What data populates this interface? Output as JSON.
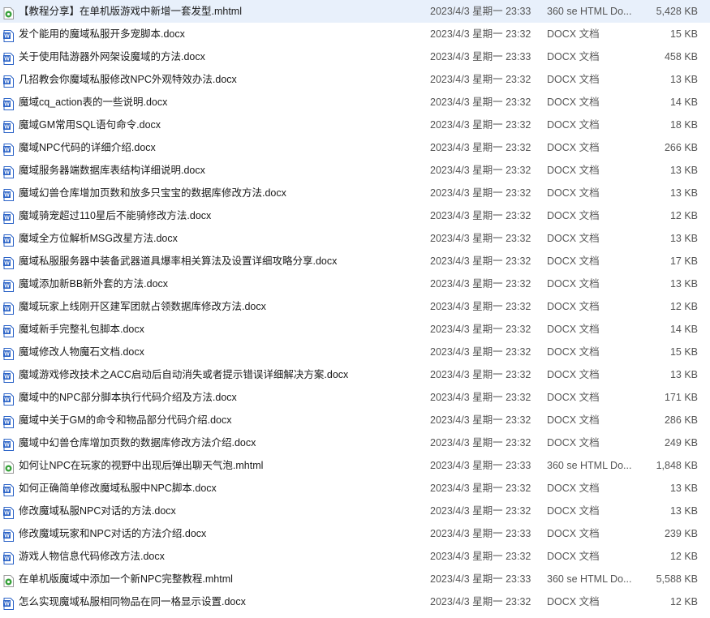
{
  "colors": {
    "selected_row_bg": "#e8f0fb",
    "docx_icon": "#2b63c7",
    "mhtml_icon": "#3aa23c"
  },
  "files": [
    {
      "name": "【教程分享】在单机版游戏中新增一套发型.mhtml",
      "date": "2023/4/3 星期一 23:33",
      "type": "360 se HTML Do...",
      "size": "5,428 KB",
      "icon": "mhtml-icon"
    },
    {
      "name": "发个能用的魔域私服开多宠脚本.docx",
      "date": "2023/4/3 星期一 23:32",
      "type": "DOCX 文档",
      "size": "15 KB",
      "icon": "docx-icon"
    },
    {
      "name": "关于使用陆游器外网架设魔域的方法.docx",
      "date": "2023/4/3 星期一 23:33",
      "type": "DOCX 文档",
      "size": "458 KB",
      "icon": "docx-icon"
    },
    {
      "name": "几招教会你魔域私服修改NPC外观特效办法.docx",
      "date": "2023/4/3 星期一 23:32",
      "type": "DOCX 文档",
      "size": "13 KB",
      "icon": "docx-icon"
    },
    {
      "name": "魔域cq_action表的一些说明.docx",
      "date": "2023/4/3 星期一 23:32",
      "type": "DOCX 文档",
      "size": "14 KB",
      "icon": "docx-icon"
    },
    {
      "name": "魔域GM常用SQL语句命令.docx",
      "date": "2023/4/3 星期一 23:32",
      "type": "DOCX 文档",
      "size": "18 KB",
      "icon": "docx-icon"
    },
    {
      "name": "魔域NPC代码的详细介绍.docx",
      "date": "2023/4/3 星期一 23:32",
      "type": "DOCX 文档",
      "size": "266 KB",
      "icon": "docx-icon"
    },
    {
      "name": "魔域服务器端数据库表结构详细说明.docx",
      "date": "2023/4/3 星期一 23:32",
      "type": "DOCX 文档",
      "size": "13 KB",
      "icon": "docx-icon"
    },
    {
      "name": "魔域幻兽仓库增加页数和放多只宝宝的数据库修改方法.docx",
      "date": "2023/4/3 星期一 23:32",
      "type": "DOCX 文档",
      "size": "13 KB",
      "icon": "docx-icon"
    },
    {
      "name": "魔域骑宠超过110星后不能骑修改方法.docx",
      "date": "2023/4/3 星期一 23:32",
      "type": "DOCX 文档",
      "size": "12 KB",
      "icon": "docx-icon"
    },
    {
      "name": "魔域全方位解析MSG改星方法.docx",
      "date": "2023/4/3 星期一 23:32",
      "type": "DOCX 文档",
      "size": "13 KB",
      "icon": "docx-icon"
    },
    {
      "name": "魔域私服服务器中装备武器道具爆率相关算法及设置详细攻略分享.docx",
      "date": "2023/4/3 星期一 23:32",
      "type": "DOCX 文档",
      "size": "17 KB",
      "icon": "docx-icon"
    },
    {
      "name": "魔域添加新BB新外套的方法.docx",
      "date": "2023/4/3 星期一 23:32",
      "type": "DOCX 文档",
      "size": "13 KB",
      "icon": "docx-icon"
    },
    {
      "name": "魔域玩家上线刚开区建军团就占领数据库修改方法.docx",
      "date": "2023/4/3 星期一 23:32",
      "type": "DOCX 文档",
      "size": "12 KB",
      "icon": "docx-icon"
    },
    {
      "name": "魔域新手完整礼包脚本.docx",
      "date": "2023/4/3 星期一 23:32",
      "type": "DOCX 文档",
      "size": "14 KB",
      "icon": "docx-icon"
    },
    {
      "name": "魔域修改人物魔石文档.docx",
      "date": "2023/4/3 星期一 23:32",
      "type": "DOCX 文档",
      "size": "15 KB",
      "icon": "docx-icon"
    },
    {
      "name": "魔域游戏修改技术之ACC启动后自动消失或者提示错误详细解决方案.docx",
      "date": "2023/4/3 星期一 23:32",
      "type": "DOCX 文档",
      "size": "13 KB",
      "icon": "docx-icon"
    },
    {
      "name": "魔域中的NPC部分脚本执行代码介绍及方法.docx",
      "date": "2023/4/3 星期一 23:32",
      "type": "DOCX 文档",
      "size": "171 KB",
      "icon": "docx-icon"
    },
    {
      "name": "魔域中关于GM的命令和物品部分代码介绍.docx",
      "date": "2023/4/3 星期一 23:32",
      "type": "DOCX 文档",
      "size": "286 KB",
      "icon": "docx-icon"
    },
    {
      "name": "魔域中幻兽仓库增加页数的数据库修改方法介绍.docx",
      "date": "2023/4/3 星期一 23:32",
      "type": "DOCX 文档",
      "size": "249 KB",
      "icon": "docx-icon"
    },
    {
      "name": "如何让NPC在玩家的视野中出现后弹出聊天气泡.mhtml",
      "date": "2023/4/3 星期一 23:33",
      "type": "360 se HTML Do...",
      "size": "1,848 KB",
      "icon": "mhtml-icon"
    },
    {
      "name": "如何正确简单修改魔域私服中NPC脚本.docx",
      "date": "2023/4/3 星期一 23:32",
      "type": "DOCX 文档",
      "size": "13 KB",
      "icon": "docx-icon"
    },
    {
      "name": "修改魔域私服NPC对话的方法.docx",
      "date": "2023/4/3 星期一 23:32",
      "type": "DOCX 文档",
      "size": "13 KB",
      "icon": "docx-icon"
    },
    {
      "name": "修改魔域玩家和NPC对话的方法介绍.docx",
      "date": "2023/4/3 星期一 23:33",
      "type": "DOCX 文档",
      "size": "239 KB",
      "icon": "docx-icon"
    },
    {
      "name": "游戏人物信息代码修改方法.docx",
      "date": "2023/4/3 星期一 23:32",
      "type": "DOCX 文档",
      "size": "12 KB",
      "icon": "docx-icon"
    },
    {
      "name": "在单机版魔域中添加一个新NPC完整教程.mhtml",
      "date": "2023/4/3 星期一 23:33",
      "type": "360 se HTML Do...",
      "size": "5,588 KB",
      "icon": "mhtml-icon"
    },
    {
      "name": "怎么实现魔域私服相同物品在同一格显示设置.docx",
      "date": "2023/4/3 星期一 23:32",
      "type": "DOCX 文档",
      "size": "12 KB",
      "icon": "docx-icon"
    }
  ]
}
